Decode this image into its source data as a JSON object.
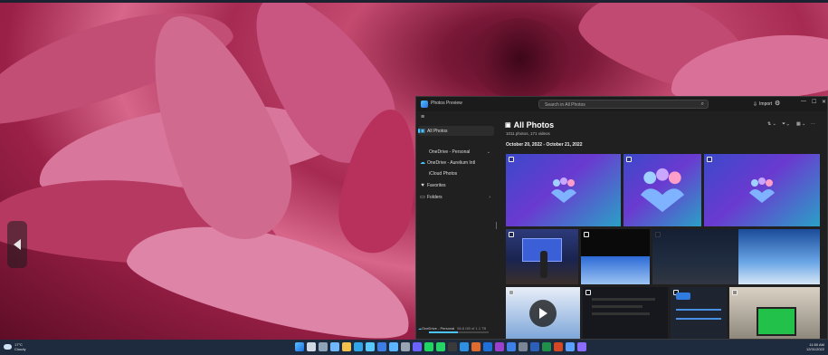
{
  "desktop": {
    "colors": {
      "petal_light": "#e27a9c",
      "petal_mid": "#c94a73",
      "petal_dark": "#7d1737"
    }
  },
  "photos_app": {
    "title": "Photos Preview",
    "search_placeholder": "Search in All Photos",
    "import_label": "Import",
    "accent": "#4cc2ff",
    "sidebar": {
      "items": [
        {
          "label": "All Photos",
          "icon": "photos-icon",
          "active": true
        },
        {
          "label": "OneDrive - Personal",
          "icon": "",
          "active": false,
          "expandable": true
        },
        {
          "label": "OneDrive - Aurelium Intl",
          "icon": "cloud-icon",
          "active": false
        },
        {
          "label": "iCloud Photos",
          "icon": "",
          "active": false
        },
        {
          "label": "Favorites",
          "icon": "heart-icon",
          "active": false
        },
        {
          "label": "Folders",
          "icon": "folder-icon",
          "active": false,
          "expandable": true
        }
      ],
      "footer": {
        "label": "OneDrive - Personal",
        "status": "56.8 GB of 1.1 TB",
        "storage_used": 0.48
      }
    },
    "main": {
      "heading": "All Photos",
      "subheading": "1011 photos, 171 videos",
      "date_range": "October 20, 2022 - October 21, 2022"
    }
  },
  "taskbar": {
    "weather": {
      "temp": "17°C",
      "condition": "Cloudy"
    },
    "clock": {
      "time": "11:50 AM",
      "date": "12/31/2022"
    },
    "pinned_icons": [
      "windows-start-icon",
      "search-icon",
      "task-view-icon",
      "widgets-icon",
      "file-explorer-icon",
      "edge-icon",
      "store-icon",
      "mail-icon",
      "photos-icon",
      "settings-icon",
      "teams-icon",
      "spotify-icon",
      "whatsapp-icon",
      "terminal-icon",
      "vscode-icon",
      "paint-icon",
      "outlook-icon",
      "onenote-icon",
      "todo-icon",
      "calculator-icon",
      "word-icon",
      "excel-icon",
      "powerpoint-icon",
      "app-icon",
      "app-icon-2"
    ]
  }
}
